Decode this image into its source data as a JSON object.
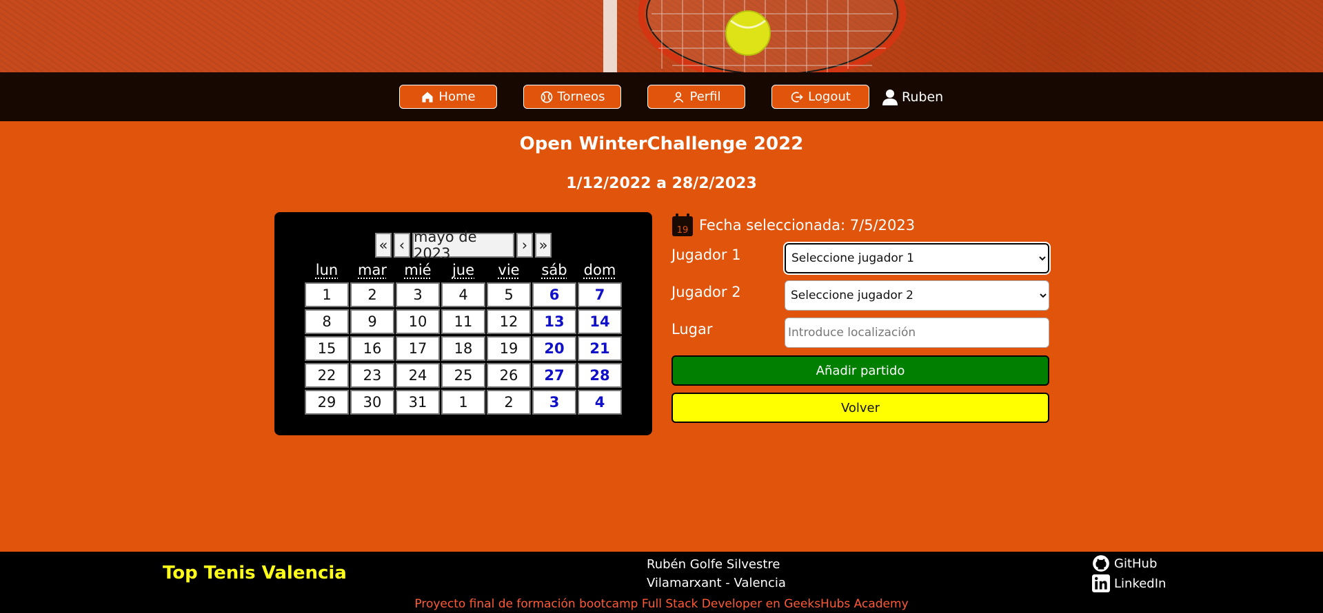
{
  "nav": {
    "items": [
      {
        "label": "Home",
        "icon": "home-icon"
      },
      {
        "label": "Torneos",
        "icon": "tennis-ball-icon"
      },
      {
        "label": "Perfil",
        "icon": "user-outline-icon"
      },
      {
        "label": "Logout",
        "icon": "logout-icon"
      }
    ],
    "user": "Ruben"
  },
  "tournament": {
    "title": "Open WinterChallenge 2022",
    "dates": "1/12/2022 a 28/2/2023"
  },
  "calendar": {
    "nav": {
      "prev_year": "«",
      "prev_month": "‹",
      "month_label": "mayo de 2023",
      "next_month": "›",
      "next_year": "»"
    },
    "weekdays": [
      "lun",
      "mar",
      "mié",
      "jue",
      "vie",
      "sáb",
      "dom"
    ],
    "weeks": [
      [
        "1",
        "2",
        "3",
        "4",
        "5",
        "6",
        "7"
      ],
      [
        "8",
        "9",
        "10",
        "11",
        "12",
        "13",
        "14"
      ],
      [
        "15",
        "16",
        "17",
        "18",
        "19",
        "20",
        "21"
      ],
      [
        "22",
        "23",
        "24",
        "25",
        "26",
        "27",
        "28"
      ],
      [
        "29",
        "30",
        "31",
        "1",
        "2",
        "3",
        "4"
      ]
    ]
  },
  "form": {
    "calendar_icon_number": "19",
    "selected_date": "Fecha seleccionada: 7/5/2023",
    "player1_label": "Jugador 1",
    "player1_value": "Seleccione jugador 1",
    "player2_label": "Jugador 2",
    "player2_value": "Seleccione jugador 2",
    "place_label": "Lugar",
    "place_placeholder": "Introduce localización",
    "add_button": "Añadir partido",
    "back_button": "Volver"
  },
  "footer": {
    "brand": "Top Tenis Valencia",
    "author": "Rubén Golfe Silvestre",
    "location": "Vilamarxant - Valencia",
    "github": "GitHub",
    "linkedin": "LinkedIn",
    "credit": "Proyecto final de formación bootcamp Full Stack Developer en GeeksHubs Academy"
  },
  "colors": {
    "background": "#e0540b",
    "navbar": "#170802",
    "add_button": "#017f01",
    "back_button": "#ffff00",
    "weekend_day": "#1010c8",
    "brand": "#ffff1a",
    "credit": "#ff5a36"
  }
}
